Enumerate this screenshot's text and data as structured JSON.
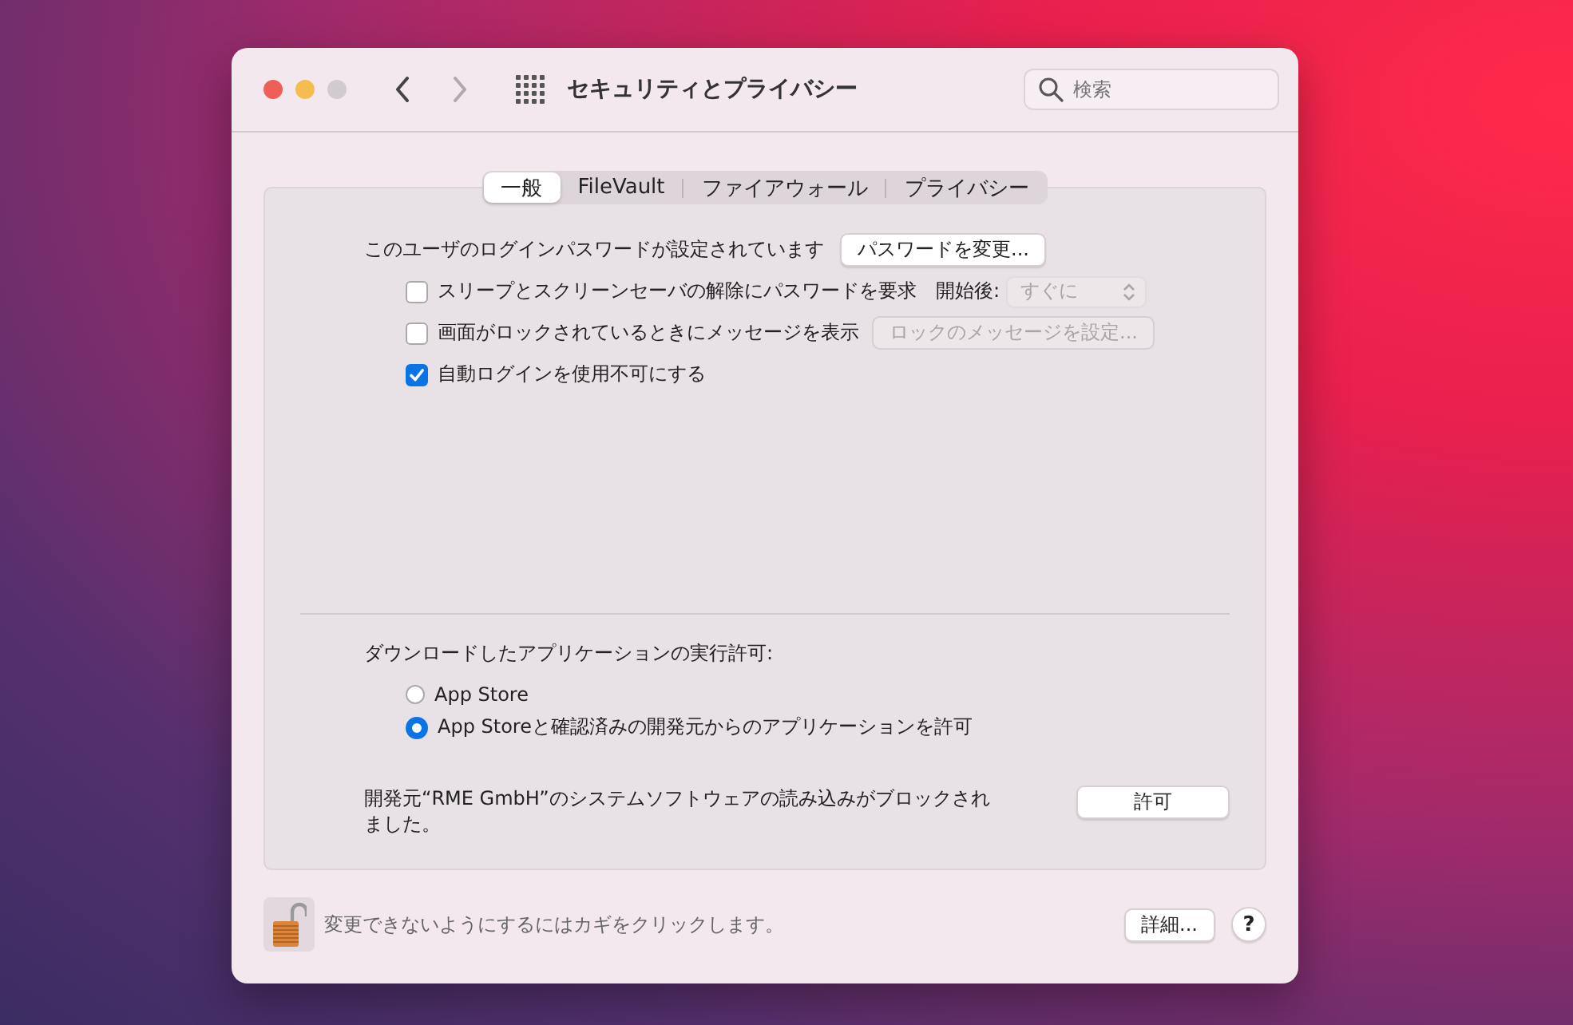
{
  "window": {
    "title": "セキュリティとプライバシー",
    "zoom_disabled": true
  },
  "toolbar": {
    "back_disabled": false,
    "forward_disabled": true,
    "search": {
      "placeholder": "検索"
    }
  },
  "tabs": [
    {
      "label": "一般",
      "selected": true
    },
    {
      "label": "FileVault",
      "selected": false
    },
    {
      "label": "ファイアウォール",
      "selected": false
    },
    {
      "label": "プライバシー",
      "selected": false
    }
  ],
  "general": {
    "password_status": "このユーザのログインパスワードが設定されています",
    "change_password_button": "パスワードを変更...",
    "options": [
      {
        "kind": "checkbox-popup",
        "label": "スリープとスクリーンセーバの解除にパスワードを要求",
        "checked": false,
        "popup_label": "開始後:",
        "popup_value": "すぐに",
        "popup_disabled": true
      },
      {
        "kind": "checkbox-button",
        "label": "画面がロックされているときにメッセージを表示",
        "checked": false,
        "button": "ロックのメッセージを設定...",
        "button_disabled": true
      },
      {
        "kind": "checkbox",
        "label": "自動ログインを使用不可にする",
        "checked": true
      }
    ],
    "downloads": {
      "heading": "ダウンロードしたアプリケーションの実行許可:",
      "options": [
        {
          "label": "App Store",
          "selected": false
        },
        {
          "label": "App Storeと確認済みの開発元からのアプリケーションを許可",
          "selected": true
        }
      ]
    },
    "blocked": {
      "message": "開発元“RME GmbH”のシステムソフトウェアの読み込みがブロックされました。",
      "button": "許可"
    }
  },
  "footer": {
    "locked": false,
    "lock_message": "変更できないようにするにはカギをクリックします。",
    "advanced_button": "詳細...",
    "help_button": "?"
  }
}
